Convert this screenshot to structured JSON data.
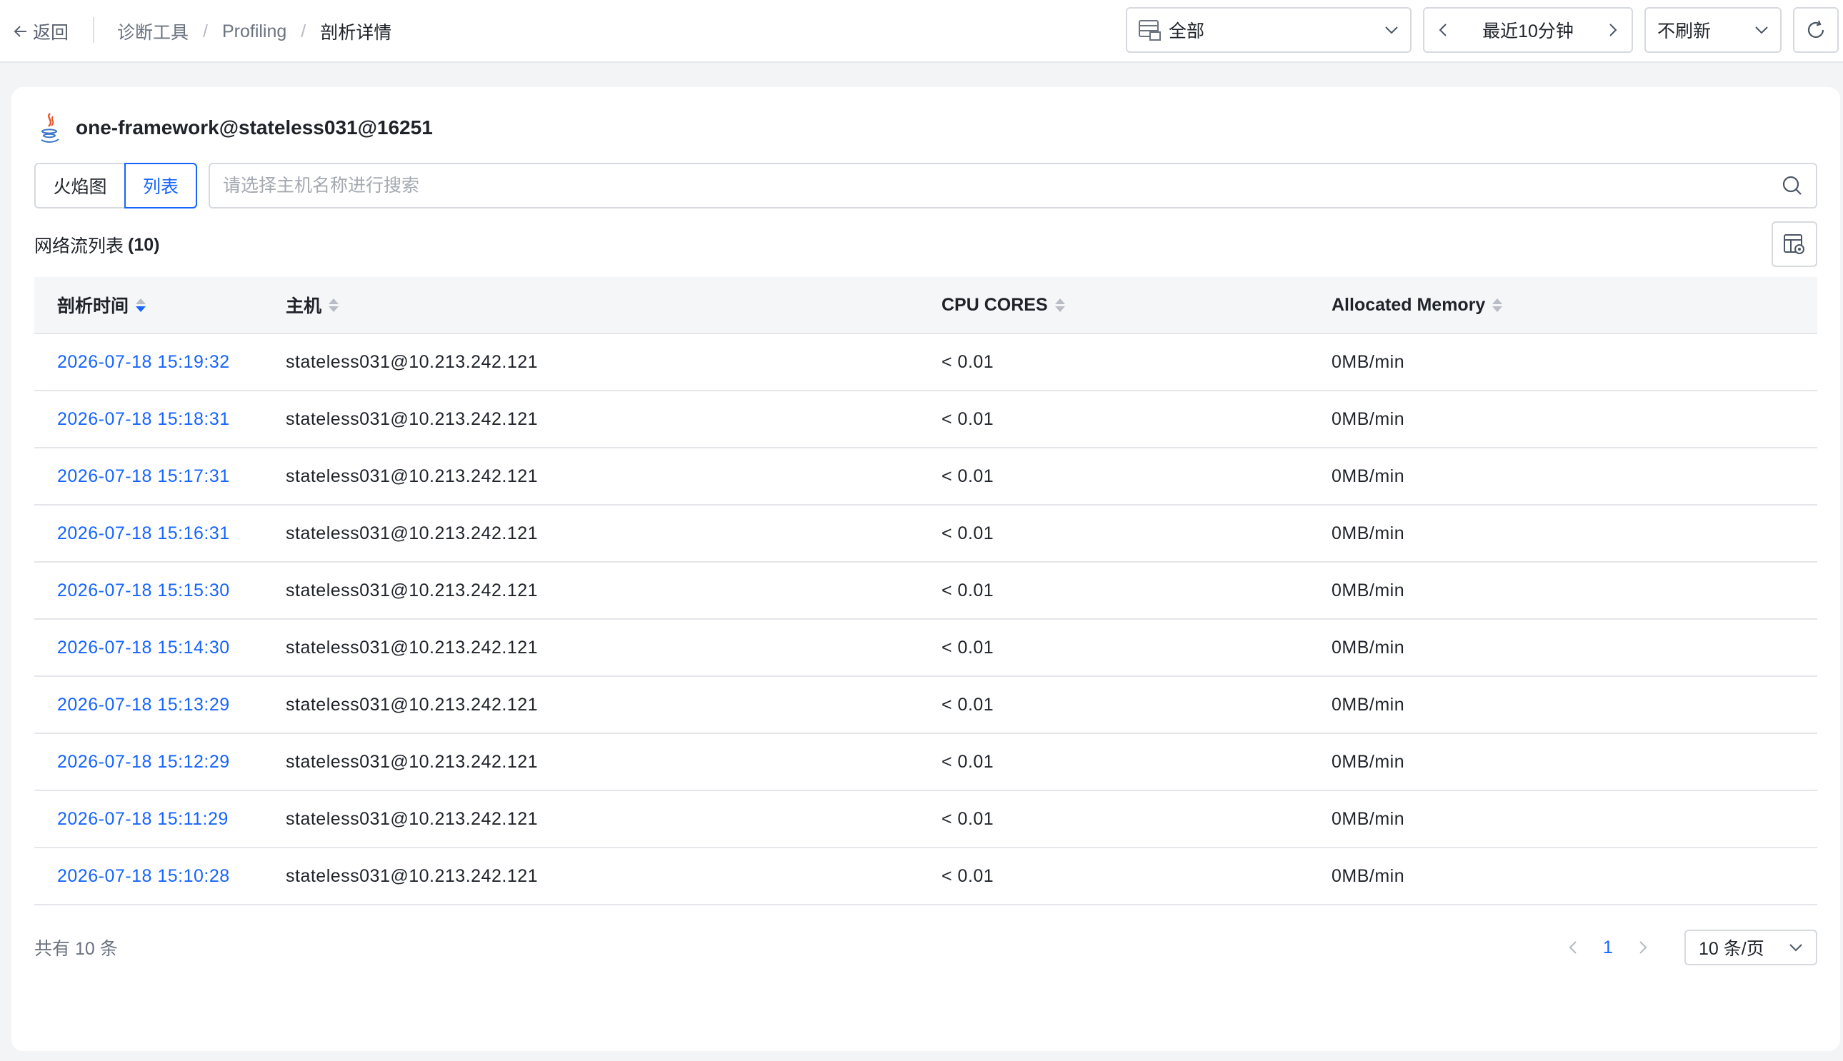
{
  "topbar": {
    "back_label": "返回",
    "breadcrumb": [
      "诊断工具",
      "Profiling",
      "剖析详情"
    ],
    "scope_label": "全部",
    "time_range_label": "最近10分钟",
    "refresh_label": "不刷新"
  },
  "app": {
    "title": "one-framework@stateless031@16251"
  },
  "view_tabs": {
    "flame": "火焰图",
    "list": "列表"
  },
  "search": {
    "placeholder": "请选择主机名称进行搜索",
    "value": ""
  },
  "list": {
    "title": "网络流列表",
    "count": "(10)"
  },
  "table": {
    "columns": [
      "剖析时间",
      "主机",
      "CPU CORES",
      "Allocated Memory"
    ],
    "rows": [
      [
        "2026-07-18 15:19:32",
        "stateless031@10.213.242.121",
        "< 0.01",
        "0MB/min"
      ],
      [
        "2026-07-18 15:18:31",
        "stateless031@10.213.242.121",
        "< 0.01",
        "0MB/min"
      ],
      [
        "2026-07-18 15:17:31",
        "stateless031@10.213.242.121",
        "< 0.01",
        "0MB/min"
      ],
      [
        "2026-07-18 15:16:31",
        "stateless031@10.213.242.121",
        "< 0.01",
        "0MB/min"
      ],
      [
        "2026-07-18 15:15:30",
        "stateless031@10.213.242.121",
        "< 0.01",
        "0MB/min"
      ],
      [
        "2026-07-18 15:14:30",
        "stateless031@10.213.242.121",
        "< 0.01",
        "0MB/min"
      ],
      [
        "2026-07-18 15:13:29",
        "stateless031@10.213.242.121",
        "< 0.01",
        "0MB/min"
      ],
      [
        "2026-07-18 15:12:29",
        "stateless031@10.213.242.121",
        "< 0.01",
        "0MB/min"
      ],
      [
        "2026-07-18 15:11:29",
        "stateless031@10.213.242.121",
        "< 0.01",
        "0MB/min"
      ],
      [
        "2026-07-18 15:10:28",
        "stateless031@10.213.242.121",
        "< 0.01",
        "0MB/min"
      ]
    ]
  },
  "footer": {
    "total_label": "共有 10 条",
    "current_page": "1",
    "page_size_label": "10 条/页"
  },
  "colors": {
    "accent": "#1664ff",
    "border": "#d6d9de",
    "background": "#f3f4f6"
  }
}
